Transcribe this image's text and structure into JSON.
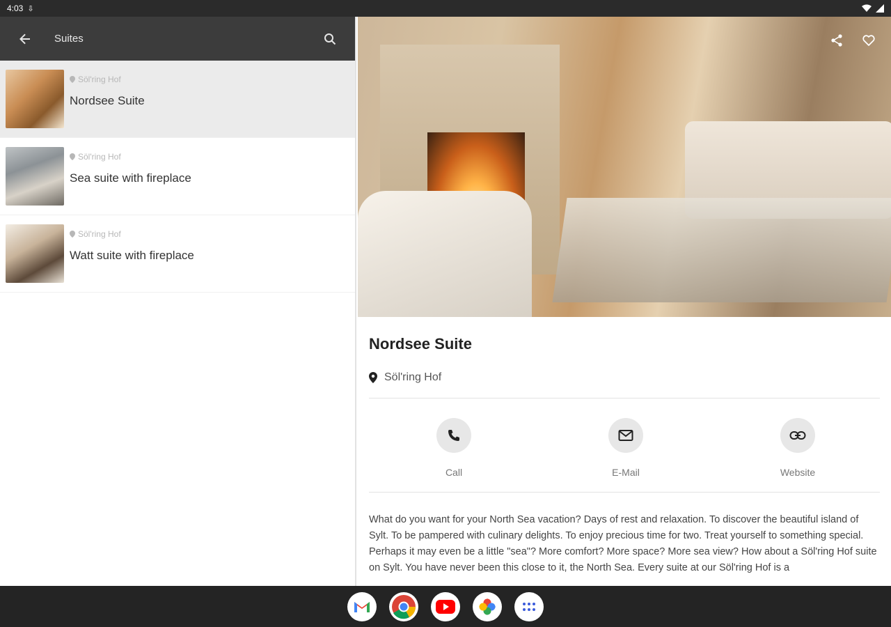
{
  "status_bar": {
    "time": "4:03"
  },
  "toolbar": {
    "title": "Suites"
  },
  "list": {
    "items": [
      {
        "location": "Söl'ring Hof",
        "title": "Nordsee Suite"
      },
      {
        "location": "Söl'ring Hof",
        "title": "Sea suite with fireplace"
      },
      {
        "location": "Söl'ring Hof",
        "title": "Watt suite with fireplace"
      }
    ]
  },
  "detail": {
    "title": "Nordsee Suite",
    "location": "Söl'ring Hof",
    "contacts": {
      "call": "Call",
      "email": "E-Mail",
      "website": "Website"
    },
    "description": "What do you want for your North Sea vacation? Days of rest and relaxation. To discover the beautiful island of Sylt. To be pampered with culinary delights. To enjoy precious time for two. Treat yourself to something special.\nPerhaps it may even be a little \"sea\"? More comfort? More space? More sea view? How about a Söl'ring Hof suite on Sylt. You have never been this close to it, the North Sea. Every suite at our Söl'ring Hof is a"
  },
  "colors": {
    "toolbar": "#3c3c3c",
    "selected_row": "#ebebeb",
    "taskbar": "#242424"
  },
  "taskbar": {
    "apps": [
      "gmail-icon",
      "chrome-icon",
      "youtube-icon",
      "photos-icon",
      "app-drawer-icon"
    ]
  }
}
